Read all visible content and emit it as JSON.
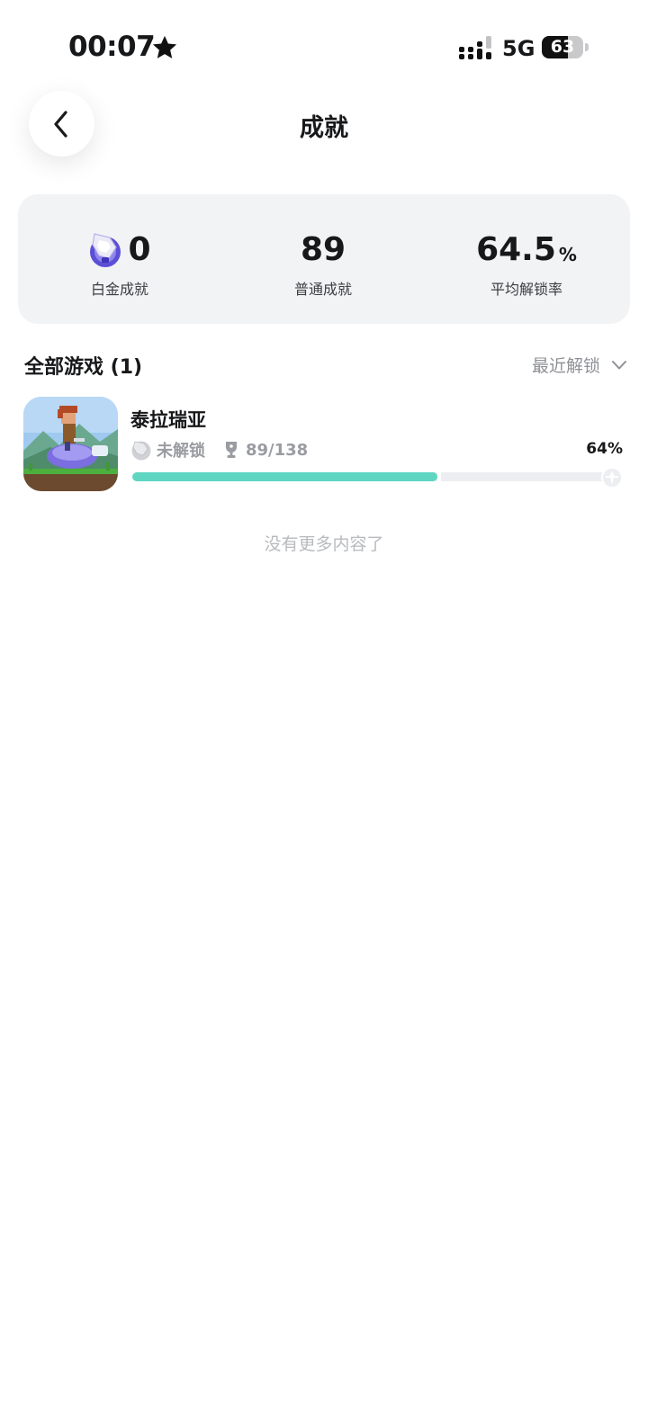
{
  "status_bar": {
    "time": "00:07",
    "network": "5G",
    "battery_level": "63",
    "battery_fraction": 0.63
  },
  "header": {
    "title": "成就",
    "back_icon": "chevron-left-icon"
  },
  "stats": {
    "platinum": {
      "value": "0",
      "label": "白金成就",
      "icon": "platinum-trophy-icon"
    },
    "normal": {
      "value": "89",
      "label": "普通成就"
    },
    "average": {
      "value": "64.5",
      "unit": "%",
      "label": "平均解锁率"
    }
  },
  "games_section": {
    "title": "全部游戏 (1)",
    "sort_label": "最近解锁"
  },
  "games": [
    {
      "name": "泰拉瑞亚",
      "platinum_status": "未解锁",
      "trophies": "89/138",
      "percent_label": "64%",
      "progress": 0.645
    }
  ],
  "footer": {
    "end_text": "没有更多内容了"
  },
  "colors": {
    "accent_teal": "#5ed6c2",
    "card_bg": "#f2f3f5",
    "platinum_purple": "#5b4fd6",
    "muted_text": "#9a9ca1"
  }
}
